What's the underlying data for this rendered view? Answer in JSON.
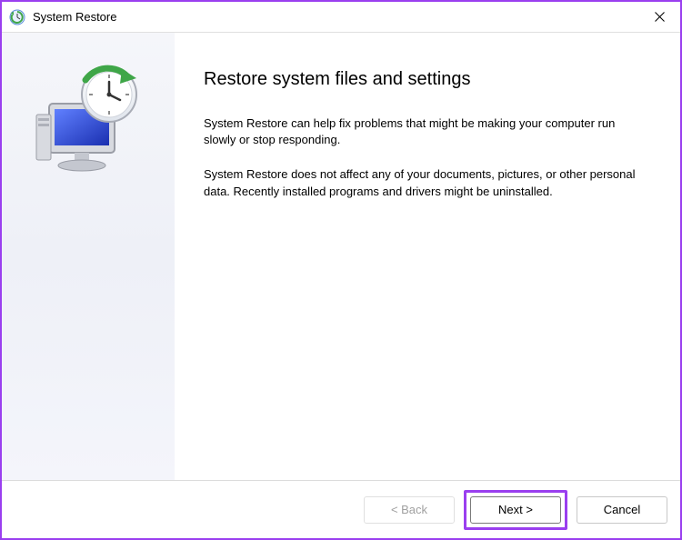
{
  "window": {
    "title": "System Restore"
  },
  "content": {
    "heading": "Restore system files and settings",
    "para1": "System Restore can help fix problems that might be making your computer run slowly or stop responding.",
    "para2": "System Restore does not affect any of your documents, pictures, or other personal data. Recently installed programs and drivers might be uninstalled."
  },
  "buttons": {
    "back": "< Back",
    "next": "Next >",
    "cancel": "Cancel"
  }
}
